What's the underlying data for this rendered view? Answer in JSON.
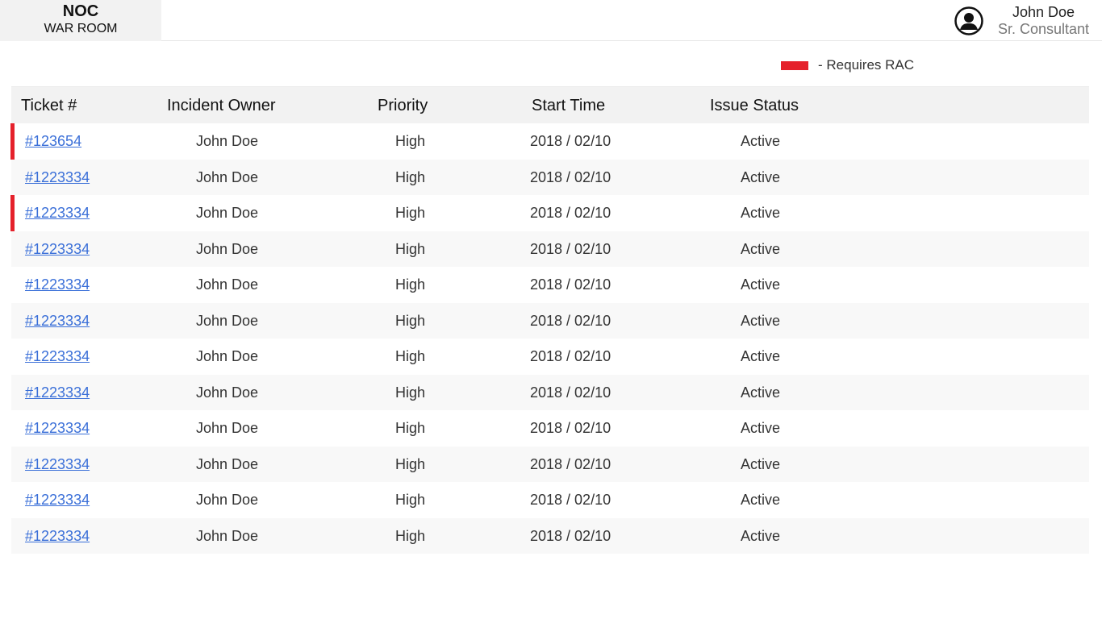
{
  "brand": {
    "title": "NOC",
    "subtitle": "WAR ROOM"
  },
  "user": {
    "name": "John Doe",
    "role": "Sr. Consultant",
    "icon": "user-circle-icon"
  },
  "legend": {
    "label": "- Requires RAC",
    "color": "#e5212b"
  },
  "table": {
    "columns": [
      "Ticket #",
      "Incident Owner",
      "Priority",
      "Start Time",
      "Issue Status"
    ],
    "rows": [
      {
        "ticket": "#123654",
        "owner": "John Doe",
        "priority": "High",
        "start": "2018 / 02/10",
        "status": "Active",
        "rac": true
      },
      {
        "ticket": "#1223334",
        "owner": "John Doe",
        "priority": "High",
        "start": "2018 / 02/10",
        "status": "Active",
        "rac": false
      },
      {
        "ticket": "#1223334",
        "owner": "John Doe",
        "priority": "High",
        "start": "2018 / 02/10",
        "status": "Active",
        "rac": true
      },
      {
        "ticket": "#1223334",
        "owner": "John Doe",
        "priority": "High",
        "start": "2018 / 02/10",
        "status": "Active",
        "rac": false
      },
      {
        "ticket": "#1223334",
        "owner": "John Doe",
        "priority": "High",
        "start": "2018 / 02/10",
        "status": "Active",
        "rac": false
      },
      {
        "ticket": "#1223334",
        "owner": "John Doe",
        "priority": "High",
        "start": "2018 / 02/10",
        "status": "Active",
        "rac": false
      },
      {
        "ticket": "#1223334",
        "owner": "John Doe",
        "priority": "High",
        "start": "2018 / 02/10",
        "status": "Active",
        "rac": false
      },
      {
        "ticket": "#1223334",
        "owner": "John Doe",
        "priority": "High",
        "start": "2018 / 02/10",
        "status": "Active",
        "rac": false
      },
      {
        "ticket": "#1223334",
        "owner": "John Doe",
        "priority": "High",
        "start": "2018 / 02/10",
        "status": "Active",
        "rac": false
      },
      {
        "ticket": "#1223334",
        "owner": "John Doe",
        "priority": "High",
        "start": "2018 / 02/10",
        "status": "Active",
        "rac": false
      },
      {
        "ticket": "#1223334",
        "owner": "John Doe",
        "priority": "High",
        "start": "2018 / 02/10",
        "status": "Active",
        "rac": false
      },
      {
        "ticket": "#1223334",
        "owner": "John Doe",
        "priority": "High",
        "start": "2018 / 02/10",
        "status": "Active",
        "rac": false
      }
    ]
  }
}
